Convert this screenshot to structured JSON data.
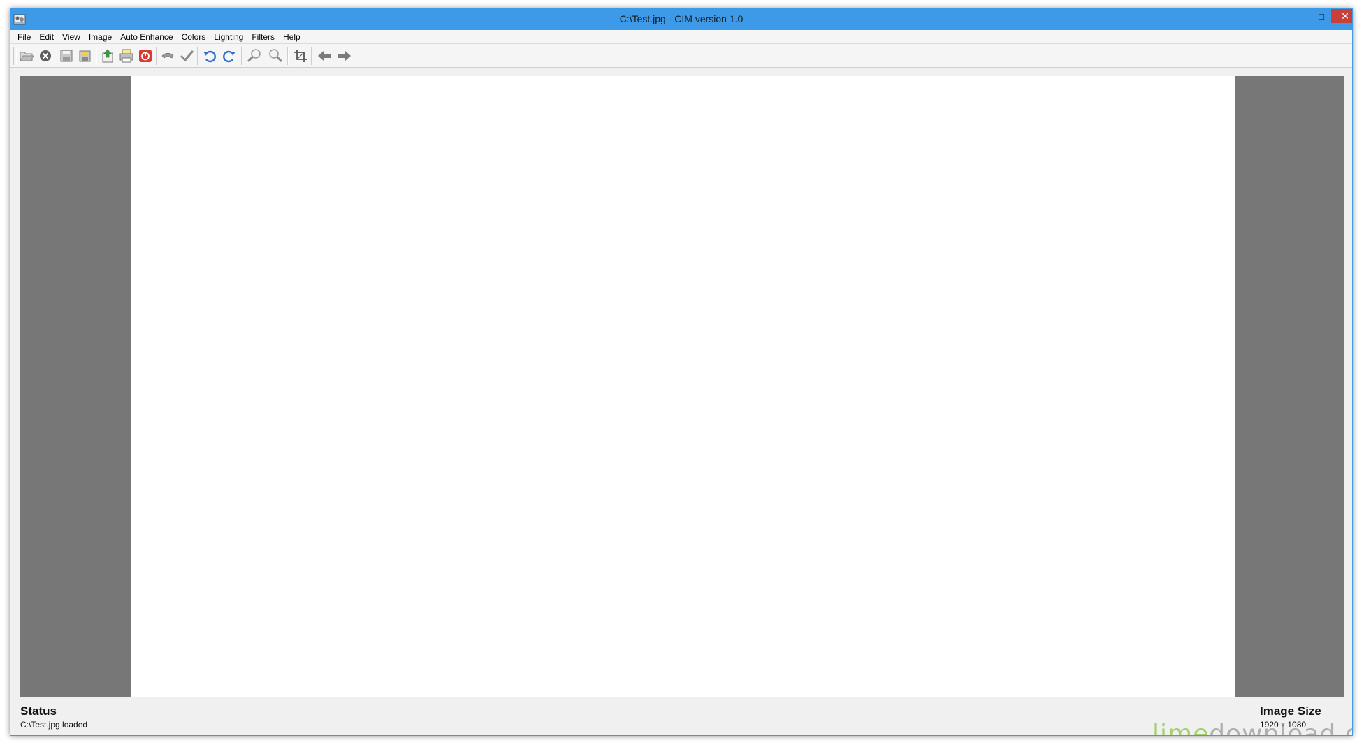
{
  "window": {
    "title": "C:\\Test.jpg - CIM version 1.0",
    "min_glyph": "–",
    "max_glyph": "□",
    "close_glyph": "✕"
  },
  "menu": [
    "File",
    "Edit",
    "View",
    "Image",
    "Auto Enhance",
    "Colors",
    "Lighting",
    "Filters",
    "Help"
  ],
  "toolbar": {
    "icons": [
      "open-folder-icon",
      "close-icon",
      "save-icon",
      "save-as-icon",
      "export-icon",
      "print-icon",
      "power-icon",
      "undo-edit-icon",
      "apply-check-icon",
      "rotate-left-icon",
      "rotate-right-icon",
      "zoom-in-icon",
      "zoom-out-icon",
      "crop-icon",
      "previous-arrow-icon",
      "next-arrow-icon"
    ]
  },
  "status": {
    "label": "Status",
    "text": "C:\\Test.jpg loaded"
  },
  "image_size": {
    "label": "Image Size",
    "text": "1920 x 1080"
  },
  "watermark": {
    "part1": "lime",
    "part2": "download.com"
  },
  "colors": {
    "titlebar": "#3d9ae8",
    "close_button": "#c7403a",
    "canvas_gray": "#777777",
    "watermark_green": "#8bc63f"
  }
}
